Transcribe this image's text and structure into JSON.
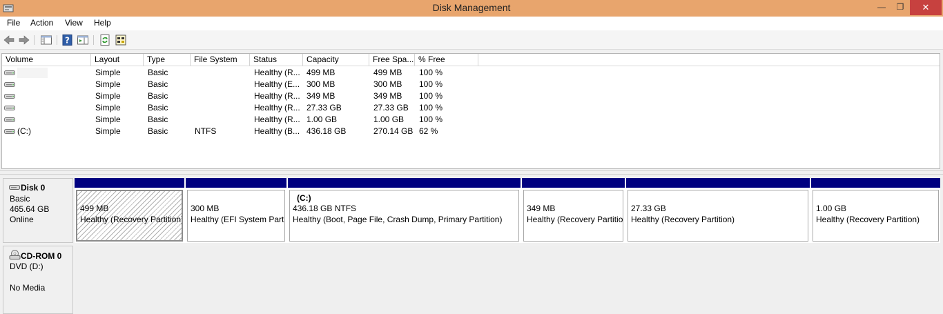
{
  "window": {
    "title": "Disk Management",
    "minimize_glyph": "—",
    "maximize_glyph": "❐",
    "close_glyph": "✕"
  },
  "menu": [
    "File",
    "Action",
    "View",
    "Help"
  ],
  "toolbar_icons": [
    "back-arrow-icon",
    "forward-arrow-icon",
    "console-tree-icon",
    "help-icon",
    "show-pane-icon",
    "refresh-icon",
    "properties-icon"
  ],
  "columns": [
    "Volume",
    "Layout",
    "Type",
    "File System",
    "Status",
    "Capacity",
    "Free Spa...",
    "% Free"
  ],
  "volumes": [
    {
      "volume": "",
      "layout": "Simple",
      "type": "Basic",
      "fs": "",
      "status": "Healthy (R...",
      "capacity": "499 MB",
      "free": "499 MB",
      "pct": "100 %"
    },
    {
      "volume": "",
      "layout": "Simple",
      "type": "Basic",
      "fs": "",
      "status": "Healthy (E...",
      "capacity": "300 MB",
      "free": "300 MB",
      "pct": "100 %"
    },
    {
      "volume": "",
      "layout": "Simple",
      "type": "Basic",
      "fs": "",
      "status": "Healthy (R...",
      "capacity": "349 MB",
      "free": "349 MB",
      "pct": "100 %"
    },
    {
      "volume": "",
      "layout": "Simple",
      "type": "Basic",
      "fs": "",
      "status": "Healthy (R...",
      "capacity": "27.33 GB",
      "free": "27.33 GB",
      "pct": "100 %"
    },
    {
      "volume": "",
      "layout": "Simple",
      "type": "Basic",
      "fs": "",
      "status": "Healthy (R...",
      "capacity": "1.00 GB",
      "free": "1.00 GB",
      "pct": "100 %"
    },
    {
      "volume": "(C:)",
      "layout": "Simple",
      "type": "Basic",
      "fs": "NTFS",
      "status": "Healthy (B...",
      "capacity": "436.18 GB",
      "free": "270.14 GB",
      "pct": "62 %"
    }
  ],
  "disk0": {
    "name": "Disk 0",
    "type": "Basic",
    "size": "465.64 GB",
    "state": "Online",
    "partitions": [
      {
        "name": "",
        "size": "499 MB",
        "status": "Healthy (Recovery Partition)",
        "selected": true
      },
      {
        "name": "",
        "size": "300 MB",
        "status": "Healthy (EFI System Parti",
        "selected": false
      },
      {
        "name": "(C:)",
        "size": "436.18 GB NTFS",
        "status": "Healthy (Boot, Page File, Crash Dump, Primary Partition)",
        "selected": false
      },
      {
        "name": "",
        "size": "349 MB",
        "status": "Healthy (Recovery Partitio",
        "selected": false
      },
      {
        "name": "",
        "size": "27.33 GB",
        "status": "Healthy (Recovery Partition)",
        "selected": false
      },
      {
        "name": "",
        "size": "1.00 GB",
        "status": "Healthy (Recovery Partition)",
        "selected": false
      }
    ]
  },
  "cdrom0": {
    "name": "CD-ROM 0",
    "drive": "DVD (D:)",
    "media": "No Media"
  },
  "colors": {
    "titlebar": "#e8a56d",
    "partition_header": "#000080",
    "close_button": "#c7413f"
  }
}
